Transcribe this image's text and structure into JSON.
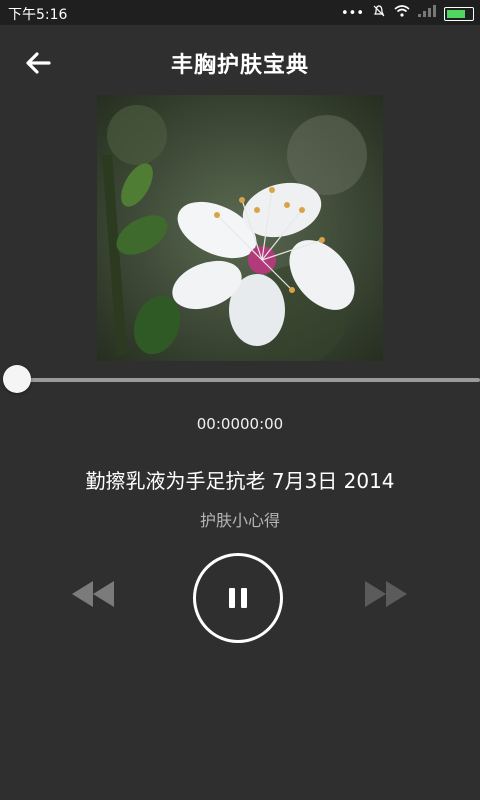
{
  "status_bar": {
    "time": "下午5:16",
    "icons": [
      "more-icon",
      "mute-icon",
      "wifi-icon",
      "signal-icon",
      "battery-icon"
    ],
    "battery_color": "#4fd65f"
  },
  "header": {
    "title": "丰胸护肤宝典",
    "back_icon": "arrow-left-icon"
  },
  "player": {
    "time_display": "00:0000:00",
    "progress_fraction": 0.0,
    "track_title": "勤擦乳液为手足抗老 7月3日 2014",
    "subtitle": "护肤小心得",
    "prev_icon": "rewind-icon",
    "play_pause_icon": "pause-icon",
    "next_icon": "fast-forward-icon"
  }
}
